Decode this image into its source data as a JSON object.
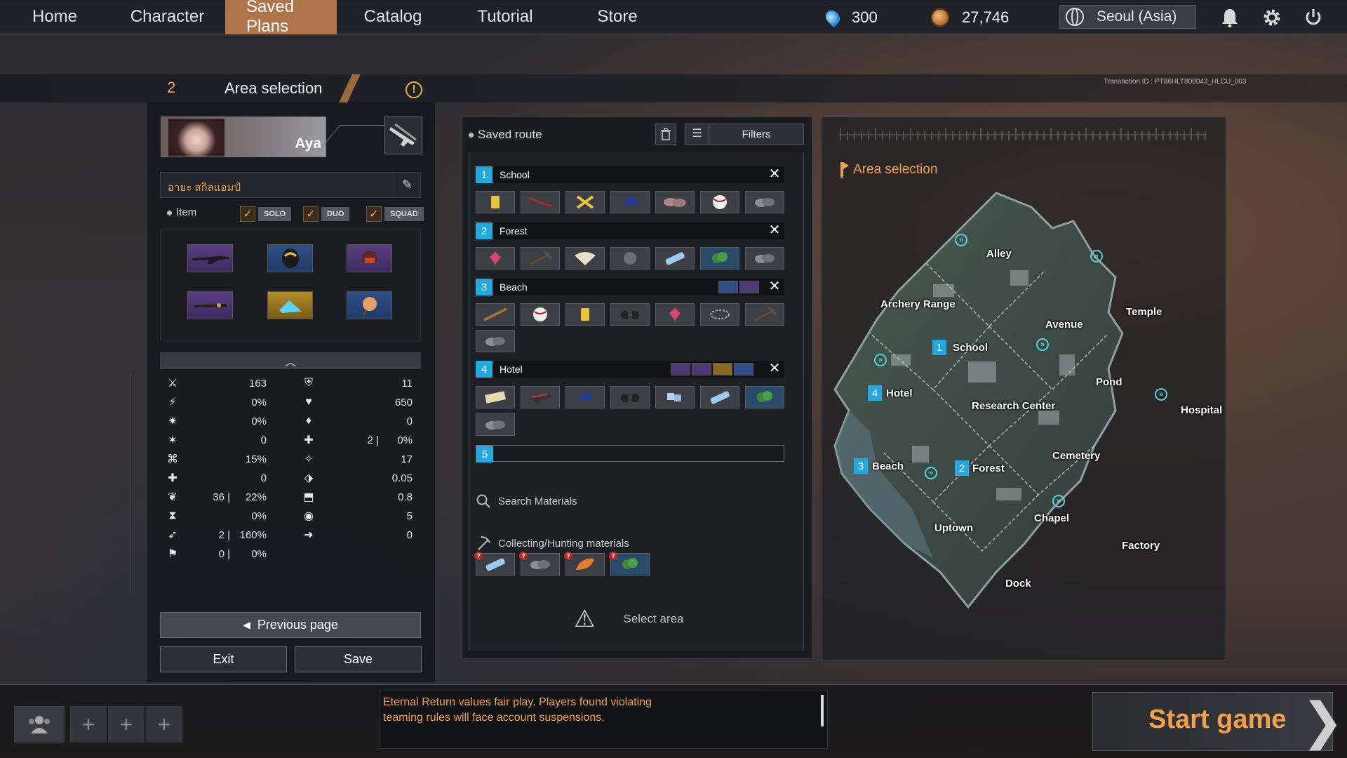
{
  "nav": {
    "tabs": [
      "Home",
      "Character",
      "Saved Plans",
      "Catalog",
      "Tutorial",
      "Store"
    ],
    "active_tab": "Saved Plans",
    "gems": "300",
    "coins": "27,746",
    "region": "Seoul (Asia)"
  },
  "header": {
    "step": "2",
    "title": "Area selection",
    "transaction_id": "Transaction ID : PT86HLT800043_HLCU_003"
  },
  "left": {
    "character_name": "Aya",
    "build_name": "อายะ สกิลแอมป์",
    "item_label": "Item",
    "modes": [
      "SOLO",
      "DUO",
      "SQUAD"
    ],
    "stats_left": [
      {
        "icon": "attack-power-icon",
        "value": "163"
      },
      {
        "icon": "attack-speed-icon",
        "value": "0%"
      },
      {
        "icon": "crit-chance-icon",
        "value": "0%"
      },
      {
        "icon": "crit-damage-icon",
        "value": "0"
      },
      {
        "icon": "skill-amp-icon",
        "value": "15%"
      },
      {
        "icon": "extra-normal-damage-icon",
        "value": "0"
      },
      {
        "icon": "life-steal-icon",
        "prefix": "36",
        "value": "22%"
      },
      {
        "icon": "cooldown-icon",
        "value": "0%"
      },
      {
        "icon": "movement-speed-icon",
        "prefix": "2",
        "value": "160%"
      },
      {
        "icon": "armor-pen-icon",
        "prefix": "0",
        "value": "0%"
      }
    ],
    "stats_right": [
      {
        "icon": "defense-icon",
        "value": "11"
      },
      {
        "icon": "max-hp-icon",
        "value": "650"
      },
      {
        "icon": "max-sp-icon",
        "value": "0"
      },
      {
        "icon": "hp-regen-icon",
        "prefix": "2",
        "value": "0%"
      },
      {
        "icon": "sp-regen-icon",
        "value": "17"
      },
      {
        "icon": "damage-reduction-icon",
        "value": "0.05"
      },
      {
        "icon": "tenacity-icon",
        "value": "0.8"
      },
      {
        "icon": "vision-icon",
        "value": "5"
      },
      {
        "icon": "attack-range-icon",
        "value": "0"
      }
    ],
    "previous_page": "Previous page",
    "exit": "Exit",
    "save": "Save"
  },
  "route": {
    "saved_route_label": "Saved route",
    "filters_label": "Filters",
    "areas": [
      {
        "num": "1",
        "name": "School"
      },
      {
        "num": "2",
        "name": "Forest"
      },
      {
        "num": "3",
        "name": "Beach"
      },
      {
        "num": "4",
        "name": "Hotel"
      }
    ],
    "empty_slot_num": "5",
    "search_materials": "Search Materials",
    "collecting_label": "Collecting/Hunting materials",
    "select_area": "Select area"
  },
  "map": {
    "title": "Area selection",
    "areas": [
      "Alley",
      "Archery Range",
      "Temple",
      "Avenue",
      "School",
      "Hotel",
      "Pond",
      "Research Center",
      "Hospital",
      "Cemetery",
      "Beach",
      "Forest",
      "Uptown",
      "Chapel",
      "Factory",
      "Dock"
    ],
    "route_markers": [
      {
        "num": "1",
        "name": "School"
      },
      {
        "num": "4",
        "name": "Hotel"
      },
      {
        "num": "3",
        "name": "Beach"
      },
      {
        "num": "2",
        "name": "Forest"
      }
    ]
  },
  "bottom": {
    "notice": "Eternal Return values fair play. Players found violating teaming rules will face account suspensions.",
    "start_game": "Start game"
  },
  "colors": {
    "accent_orange": "#f0a048",
    "route_blue": "#23a9df",
    "active_tab": "#b0744a"
  }
}
